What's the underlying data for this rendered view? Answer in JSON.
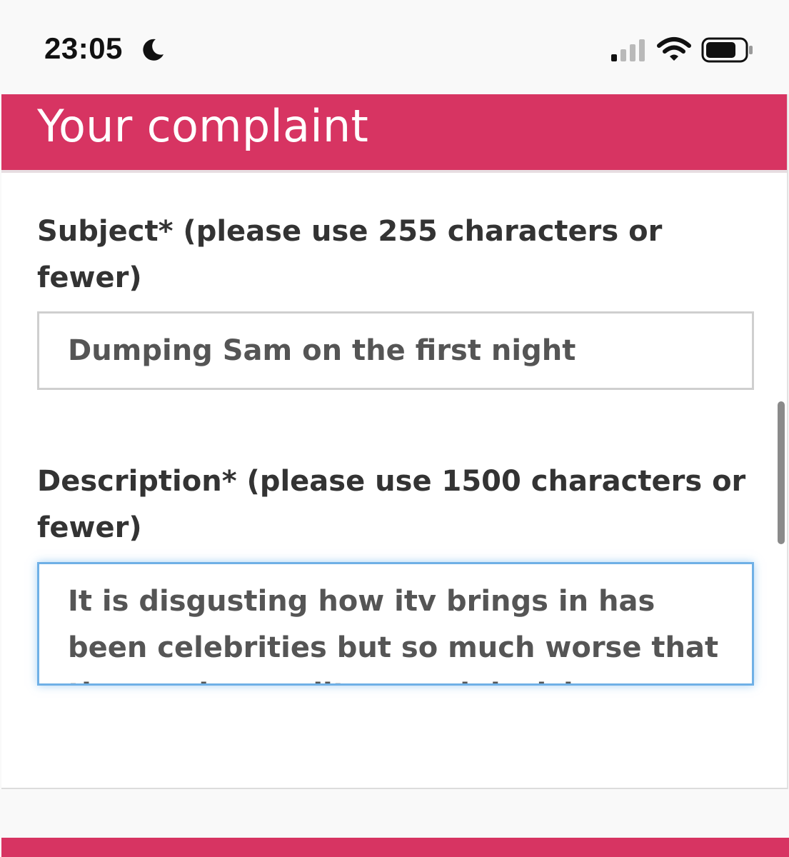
{
  "status_bar": {
    "time": "23:05",
    "icons": [
      "moon-icon",
      "signal-icon",
      "wifi-icon",
      "battery-icon"
    ]
  },
  "form": {
    "title": "Your complaint",
    "subject": {
      "label": "Subject* (please use 255 characters or fewer)",
      "value": "Dumping Sam on the first night"
    },
    "description": {
      "label": "Description* (please use 1500 characters or fewer)",
      "value": "It is disgusting how itv brings in has been celebrities but so much worse that they make a split second decision"
    }
  },
  "colors": {
    "accent": "#d73462",
    "focus_border": "#6fb0e6",
    "label_text": "#333333",
    "input_text": "#555555"
  }
}
